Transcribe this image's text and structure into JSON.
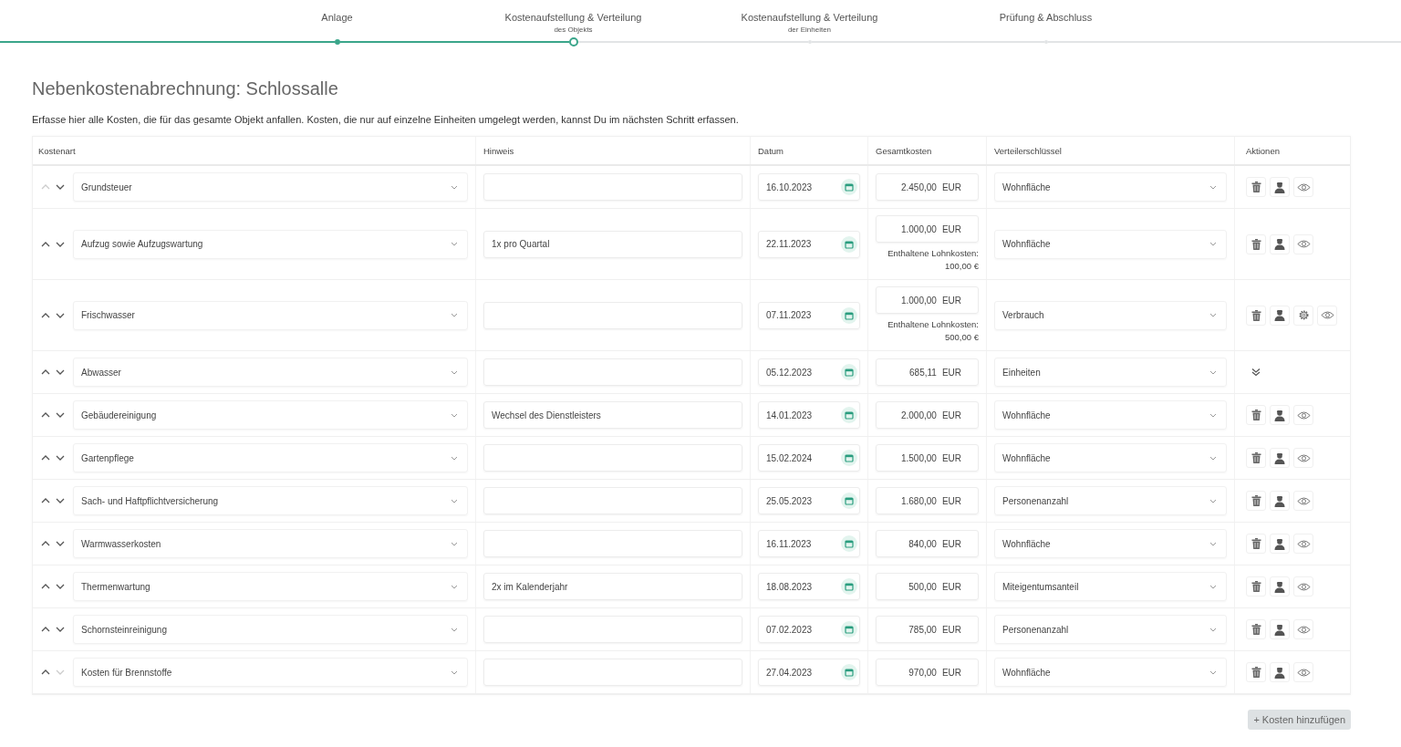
{
  "steps": [
    {
      "label": "Anlage",
      "completed": true,
      "selected": false
    },
    {
      "label": "Kostenaufstellung & Verteilung",
      "sublabel": "des Objekts",
      "completed": false,
      "selected": true
    },
    {
      "label": "Kostenaufstellung & Verteilung",
      "sublabel": "der Einheiten",
      "completed": false,
      "selected": false
    },
    {
      "label": "Prüfung & Abschluss",
      "completed": false,
      "selected": false
    }
  ],
  "title": "Nebenkostenabrechnung: Schlossalle",
  "intro": "Erfasse hier alle Kosten, die für das gesamte Objekt anfallen. Kosten, die nur auf einzelne Einheiten umgelegt werden, kannst Du im nächsten Schritt erfassen.",
  "columns": [
    "Kostenart",
    "Hinweis",
    "Datum",
    "Gesamtkosten",
    "Verteilerschlüssel",
    "Aktionen"
  ],
  "rows": [
    {
      "up_disabled": true,
      "down_disabled": false,
      "kostenart": "Grundsteuer",
      "hinweis": "",
      "datum": "16.10.2023",
      "betrag": "2.450,00",
      "waehrung": "EUR",
      "schluessel": "Wohnfläche",
      "actions": [
        {
          "kind": "delete"
        },
        {
          "kind": "person"
        },
        {
          "kind": "view"
        }
      ]
    },
    {
      "up_disabled": false,
      "down_disabled": false,
      "kostenart": "Aufzug sowie Aufzugswartung",
      "hinweis": "1x pro Quartal",
      "datum": "22.11.2023",
      "betrag": "1.000,00",
      "waehrung": "EUR",
      "lohn_label": "Enthaltene Lohnkosten:",
      "lohn_value": "100,00 €",
      "schluessel": "Wohnfläche",
      "actions": [
        {
          "kind": "delete"
        },
        {
          "kind": "person"
        },
        {
          "kind": "view"
        }
      ]
    },
    {
      "up_disabled": false,
      "down_disabled": false,
      "kostenart": "Frischwasser",
      "hinweis": "",
      "datum": "07.11.2023",
      "betrag": "1.000,00",
      "waehrung": "EUR",
      "lohn_label": "Enthaltene Lohnkosten:",
      "lohn_value": "500,00 €",
      "schluessel": "Verbrauch",
      "actions": [
        {
          "kind": "delete"
        },
        {
          "kind": "person"
        },
        {
          "kind": "settings"
        },
        {
          "kind": "view"
        }
      ]
    },
    {
      "up_disabled": false,
      "down_disabled": false,
      "kostenart": "Abwasser",
      "hinweis": "",
      "datum": "05.12.2023",
      "betrag": "685,11",
      "waehrung": "EUR",
      "schluessel": "Einheiten",
      "actions": [
        {
          "kind": "expand"
        }
      ]
    },
    {
      "up_disabled": false,
      "down_disabled": false,
      "kostenart": "Gebäudereinigung",
      "hinweis": "Wechsel des Dienstleisters",
      "datum": "14.01.2023",
      "betrag": "2.000,00",
      "waehrung": "EUR",
      "schluessel": "Wohnfläche",
      "actions": [
        {
          "kind": "delete"
        },
        {
          "kind": "person"
        },
        {
          "kind": "view"
        }
      ]
    },
    {
      "up_disabled": false,
      "down_disabled": false,
      "kostenart": "Gartenpflege",
      "hinweis": "",
      "datum": "15.02.2024",
      "betrag": "1.500,00",
      "waehrung": "EUR",
      "schluessel": "Wohnfläche",
      "actions": [
        {
          "kind": "delete"
        },
        {
          "kind": "person"
        },
        {
          "kind": "view"
        }
      ]
    },
    {
      "up_disabled": false,
      "down_disabled": false,
      "kostenart": "Sach- und Haftpflichtversicherung",
      "hinweis": "",
      "datum": "25.05.2023",
      "betrag": "1.680,00",
      "waehrung": "EUR",
      "schluessel": "Personenanzahl",
      "actions": [
        {
          "kind": "delete"
        },
        {
          "kind": "person"
        },
        {
          "kind": "view"
        }
      ]
    },
    {
      "up_disabled": false,
      "down_disabled": false,
      "kostenart": "Warmwasserkosten",
      "hinweis": "",
      "datum": "16.11.2023",
      "betrag": "840,00",
      "waehrung": "EUR",
      "schluessel": "Wohnfläche",
      "actions": [
        {
          "kind": "delete"
        },
        {
          "kind": "person"
        },
        {
          "kind": "view"
        }
      ]
    },
    {
      "up_disabled": false,
      "down_disabled": false,
      "kostenart": "Thermenwartung",
      "hinweis": "2x im Kalenderjahr",
      "datum": "18.08.2023",
      "betrag": "500,00",
      "waehrung": "EUR",
      "schluessel": "Miteigentumsanteil",
      "actions": [
        {
          "kind": "delete"
        },
        {
          "kind": "person"
        },
        {
          "kind": "view"
        }
      ]
    },
    {
      "up_disabled": false,
      "down_disabled": false,
      "kostenart": "Schornsteinreinigung",
      "hinweis": "",
      "datum": "07.02.2023",
      "betrag": "785,00",
      "waehrung": "EUR",
      "schluessel": "Personenanzahl",
      "actions": [
        {
          "kind": "delete"
        },
        {
          "kind": "person"
        },
        {
          "kind": "view"
        }
      ]
    },
    {
      "up_disabled": false,
      "down_disabled": true,
      "kostenart": "Kosten für Brennstoffe",
      "hinweis": "",
      "datum": "27.04.2023",
      "betrag": "970,00",
      "waehrung": "EUR",
      "schluessel": "Wohnfläche",
      "actions": [
        {
          "kind": "delete"
        },
        {
          "kind": "person"
        },
        {
          "kind": "view"
        }
      ]
    }
  ],
  "add_button": "+ Kosten hinzufügen"
}
